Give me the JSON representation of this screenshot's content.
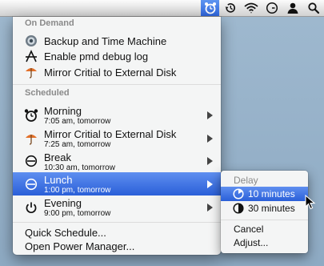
{
  "menubar": {
    "items": [
      {
        "name": "power-manager-menu-icon",
        "active": true
      },
      {
        "name": "time-machine-icon"
      },
      {
        "name": "wifi-icon"
      },
      {
        "name": "clock-icon"
      },
      {
        "name": "user-icon"
      },
      {
        "name": "spotlight-search-icon"
      }
    ]
  },
  "menu": {
    "on_demand_header": "On Demand",
    "on_demand": [
      {
        "label": "Backup and Time Machine",
        "icon": "time-machine-disc-icon"
      },
      {
        "label": "Enable pmd debug log",
        "icon": "debug-tool-icon"
      },
      {
        "label": "Mirror Critial to External Disk",
        "icon": "umbrella-icon"
      }
    ],
    "scheduled_header": "Scheduled",
    "scheduled": [
      {
        "label": "Morning",
        "time": "7:05 am, tomorrow",
        "icon": "alarm-clock-icon"
      },
      {
        "label": "Mirror Critial to External Disk",
        "time": "7:25 am, tomorrow",
        "icon": "umbrella-icon"
      },
      {
        "label": "Break",
        "time": "10:30 am, tomorrow",
        "icon": "sleep-icon"
      },
      {
        "label": "Lunch",
        "time": "1:00 pm, tomorrow",
        "icon": "sleep-icon",
        "highlighted": true
      },
      {
        "label": "Evening",
        "time": "9:00 pm, tomorrow",
        "icon": "power-icon"
      }
    ],
    "quick_schedule": "Quick Schedule...",
    "open_pm": "Open Power Manager..."
  },
  "submenu": {
    "header": "Delay",
    "options": [
      {
        "label": "10 minutes",
        "icon": "timer-10-icon",
        "highlighted": true
      },
      {
        "label": "30 minutes",
        "icon": "timer-30-icon"
      }
    ],
    "cancel": "Cancel",
    "adjust": "Adjust..."
  },
  "colors": {
    "highlight": "#3a6fe0",
    "desktop": "#98b3ca"
  }
}
